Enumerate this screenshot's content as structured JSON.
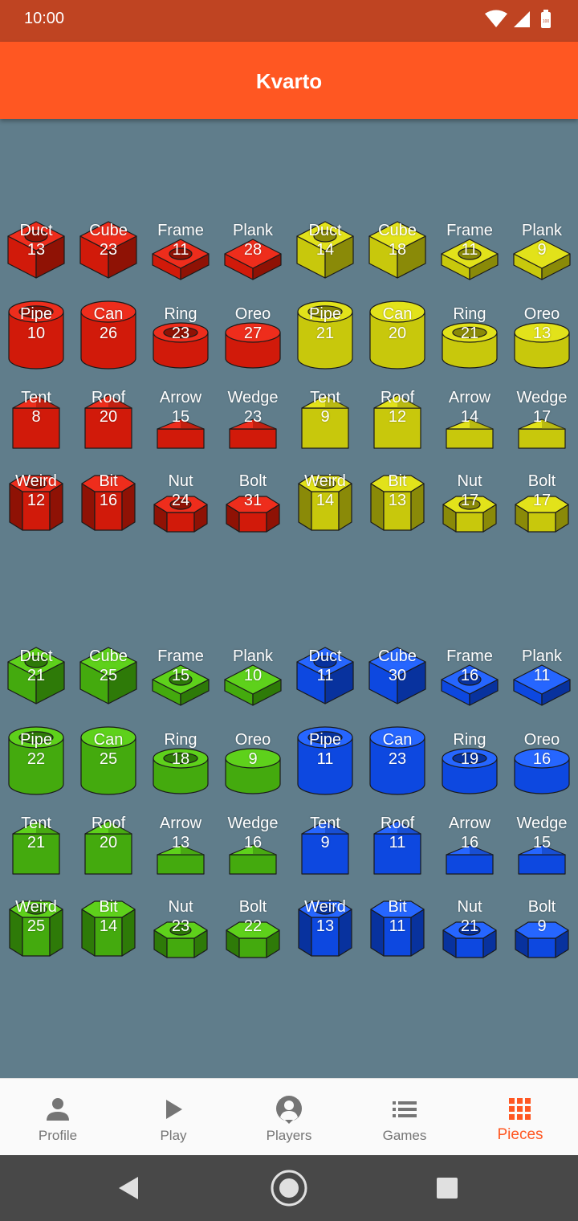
{
  "status_bar": {
    "time": "10:00",
    "battery_text": "100"
  },
  "app_bar": {
    "title": "Kvarto"
  },
  "colors": {
    "red": {
      "base": "#d11a0a",
      "light": "#ee2d1c",
      "dark": "#8f1205"
    },
    "yellow": {
      "base": "#c8c80c",
      "light": "#e2e21a",
      "dark": "#8a8a08"
    },
    "green": {
      "base": "#44aa0e",
      "light": "#5ed11b",
      "dark": "#2e7a08"
    },
    "blue": {
      "base": "#0d48e0",
      "light": "#2666ff",
      "dark": "#08329e"
    }
  },
  "pieces": [
    {
      "name": "Duct",
      "count": "13",
      "shape": "duct",
      "color": "red"
    },
    {
      "name": "Cube",
      "count": "23",
      "shape": "cube",
      "color": "red"
    },
    {
      "name": "Frame",
      "count": "11",
      "shape": "frame",
      "color": "red"
    },
    {
      "name": "Plank",
      "count": "28",
      "shape": "plank",
      "color": "red"
    },
    {
      "name": "Duct",
      "count": "14",
      "shape": "duct",
      "color": "yellow"
    },
    {
      "name": "Cube",
      "count": "18",
      "shape": "cube",
      "color": "yellow"
    },
    {
      "name": "Frame",
      "count": "11",
      "shape": "frame",
      "color": "yellow"
    },
    {
      "name": "Plank",
      "count": "9",
      "shape": "plank",
      "color": "yellow"
    },
    {
      "name": "Pipe",
      "count": "10",
      "shape": "pipe",
      "color": "red"
    },
    {
      "name": "Can",
      "count": "26",
      "shape": "can",
      "color": "red"
    },
    {
      "name": "Ring",
      "count": "23",
      "shape": "ring",
      "color": "red"
    },
    {
      "name": "Oreo",
      "count": "27",
      "shape": "oreo",
      "color": "red"
    },
    {
      "name": "Pipe",
      "count": "21",
      "shape": "pipe",
      "color": "yellow"
    },
    {
      "name": "Can",
      "count": "20",
      "shape": "can",
      "color": "yellow"
    },
    {
      "name": "Ring",
      "count": "21",
      "shape": "ring",
      "color": "yellow"
    },
    {
      "name": "Oreo",
      "count": "13",
      "shape": "oreo",
      "color": "yellow"
    },
    {
      "name": "Tent",
      "count": "8",
      "shape": "tent",
      "color": "red"
    },
    {
      "name": "Roof",
      "count": "20",
      "shape": "roof",
      "color": "red"
    },
    {
      "name": "Arrow",
      "count": "15",
      "shape": "arrow",
      "color": "red"
    },
    {
      "name": "Wedge",
      "count": "23",
      "shape": "wedge",
      "color": "red"
    },
    {
      "name": "Tent",
      "count": "9",
      "shape": "tent",
      "color": "yellow"
    },
    {
      "name": "Roof",
      "count": "12",
      "shape": "roof",
      "color": "yellow"
    },
    {
      "name": "Arrow",
      "count": "14",
      "shape": "arrow",
      "color": "yellow"
    },
    {
      "name": "Wedge",
      "count": "17",
      "shape": "wedge",
      "color": "yellow"
    },
    {
      "name": "Weird",
      "count": "12",
      "shape": "weird",
      "color": "red"
    },
    {
      "name": "Bit",
      "count": "16",
      "shape": "bit",
      "color": "red"
    },
    {
      "name": "Nut",
      "count": "24",
      "shape": "nut",
      "color": "red"
    },
    {
      "name": "Bolt",
      "count": "31",
      "shape": "bolt",
      "color": "red"
    },
    {
      "name": "Weird",
      "count": "14",
      "shape": "weird",
      "color": "yellow"
    },
    {
      "name": "Bit",
      "count": "13",
      "shape": "bit",
      "color": "yellow"
    },
    {
      "name": "Nut",
      "count": "17",
      "shape": "nut",
      "color": "yellow"
    },
    {
      "name": "Bolt",
      "count": "17",
      "shape": "bolt",
      "color": "yellow"
    },
    {
      "name": "Duct",
      "count": "21",
      "shape": "duct",
      "color": "green"
    },
    {
      "name": "Cube",
      "count": "25",
      "shape": "cube",
      "color": "green"
    },
    {
      "name": "Frame",
      "count": "15",
      "shape": "frame",
      "color": "green"
    },
    {
      "name": "Plank",
      "count": "10",
      "shape": "plank",
      "color": "green"
    },
    {
      "name": "Duct",
      "count": "11",
      "shape": "duct",
      "color": "blue"
    },
    {
      "name": "Cube",
      "count": "30",
      "shape": "cube",
      "color": "blue"
    },
    {
      "name": "Frame",
      "count": "16",
      "shape": "frame",
      "color": "blue"
    },
    {
      "name": "Plank",
      "count": "11",
      "shape": "plank",
      "color": "blue"
    },
    {
      "name": "Pipe",
      "count": "22",
      "shape": "pipe",
      "color": "green"
    },
    {
      "name": "Can",
      "count": "25",
      "shape": "can",
      "color": "green"
    },
    {
      "name": "Ring",
      "count": "18",
      "shape": "ring",
      "color": "green"
    },
    {
      "name": "Oreo",
      "count": "9",
      "shape": "oreo",
      "color": "green"
    },
    {
      "name": "Pipe",
      "count": "11",
      "shape": "pipe",
      "color": "blue"
    },
    {
      "name": "Can",
      "count": "23",
      "shape": "can",
      "color": "blue"
    },
    {
      "name": "Ring",
      "count": "19",
      "shape": "ring",
      "color": "blue"
    },
    {
      "name": "Oreo",
      "count": "16",
      "shape": "oreo",
      "color": "blue"
    },
    {
      "name": "Tent",
      "count": "21",
      "shape": "tent",
      "color": "green"
    },
    {
      "name": "Roof",
      "count": "20",
      "shape": "roof",
      "color": "green"
    },
    {
      "name": "Arrow",
      "count": "13",
      "shape": "arrow",
      "color": "green"
    },
    {
      "name": "Wedge",
      "count": "16",
      "shape": "wedge",
      "color": "green"
    },
    {
      "name": "Tent",
      "count": "9",
      "shape": "tent",
      "color": "blue"
    },
    {
      "name": "Roof",
      "count": "11",
      "shape": "roof",
      "color": "blue"
    },
    {
      "name": "Arrow",
      "count": "16",
      "shape": "arrow",
      "color": "blue"
    },
    {
      "name": "Wedge",
      "count": "15",
      "shape": "wedge",
      "color": "blue"
    },
    {
      "name": "Weird",
      "count": "25",
      "shape": "weird",
      "color": "green"
    },
    {
      "name": "Bit",
      "count": "14",
      "shape": "bit",
      "color": "green"
    },
    {
      "name": "Nut",
      "count": "23",
      "shape": "nut",
      "color": "green"
    },
    {
      "name": "Bolt",
      "count": "22",
      "shape": "bolt",
      "color": "green"
    },
    {
      "name": "Weird",
      "count": "13",
      "shape": "weird",
      "color": "blue"
    },
    {
      "name": "Bit",
      "count": "11",
      "shape": "bit",
      "color": "blue"
    },
    {
      "name": "Nut",
      "count": "21",
      "shape": "nut",
      "color": "blue"
    },
    {
      "name": "Bolt",
      "count": "9",
      "shape": "bolt",
      "color": "blue"
    }
  ],
  "bottom_nav": {
    "items": [
      {
        "label": "Profile",
        "icon": "person-icon",
        "active": false
      },
      {
        "label": "Play",
        "icon": "play-icon",
        "active": false
      },
      {
        "label": "Players",
        "icon": "account-circle-icon",
        "active": false
      },
      {
        "label": "Games",
        "icon": "list-icon",
        "active": false
      },
      {
        "label": "Pieces",
        "icon": "grid-icon",
        "active": true
      }
    ],
    "active_color": "#ff5722",
    "inactive_color": "#757575"
  }
}
